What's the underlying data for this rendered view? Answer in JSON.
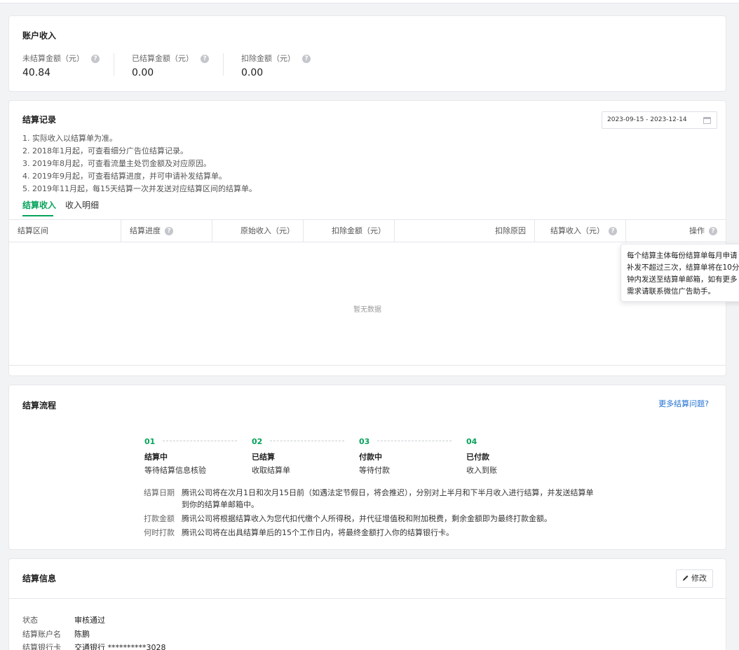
{
  "income": {
    "title": "账户收入",
    "stats": [
      {
        "label": "未结算金额（元）",
        "value": "40.84"
      },
      {
        "label": "已结算金额（元）",
        "value": "0.00"
      },
      {
        "label": "扣除金额（元）",
        "value": "0.00"
      }
    ]
  },
  "records": {
    "title": "结算记录",
    "date_range": "2023-09-15 - 2023-12-14",
    "notes": [
      "1. 实际收入以结算单为准。",
      "2. 2018年1月起，可查看细分广告位结算记录。",
      "3. 2019年8月起，可查看流量主处罚金额及对应原因。",
      "4. 2019年9月起，可查看结算进度，并可申请补发结算单。",
      "5. 2019年11月起，每15天结算一次并发送对应结算区间的结算单。"
    ],
    "tabs": [
      "结算收入",
      "收入明细"
    ],
    "columns": [
      "结算区间",
      "结算进度",
      "原始收入（元）",
      "扣除金额（元）",
      "扣除原因",
      "结算收入（元）",
      "操作"
    ],
    "empty_text": "暂无数据",
    "tooltip": "每个结算主体每份结算单每月申请补发不超过三次，结算单将在10分钟内发送至结算单邮箱，如有更多需求请联系微信广告助手。"
  },
  "flow": {
    "title": "结算流程",
    "more_link": "更多结算问题?",
    "steps": [
      {
        "num": "01",
        "title": "结算中",
        "desc": "等待结算信息核验"
      },
      {
        "num": "02",
        "title": "已结算",
        "desc": "收取结算单"
      },
      {
        "num": "03",
        "title": "付款中",
        "desc": "等待付款"
      },
      {
        "num": "04",
        "title": "已付款",
        "desc": "收入到账"
      }
    ],
    "rows": [
      {
        "label": "结算日期",
        "text": "腾讯公司将在次月1日和次月15日前（如遇法定节假日，将会推迟），分别对上半月和下半月收入进行结算，并发送结算单到你的结算单邮箱中。"
      },
      {
        "label": "打款金额",
        "text": "腾讯公司将根据结算收入为您代扣代缴个人所得税，并代征增值税和附加税费，剩余金额即为最终打款金额。"
      },
      {
        "label": "何时打款",
        "text": "腾讯公司将在出具结算单后的15个工作日内，将最终金额打入你的结算银行卡。"
      }
    ]
  },
  "info": {
    "title": "结算信息",
    "edit_label": "修改",
    "rows": [
      {
        "label": "状态",
        "value": "审核通过"
      },
      {
        "label": "结算账户名",
        "value": "陈鹏"
      },
      {
        "label": "结算银行卡",
        "value": "交通银行 **********3028"
      }
    ]
  }
}
